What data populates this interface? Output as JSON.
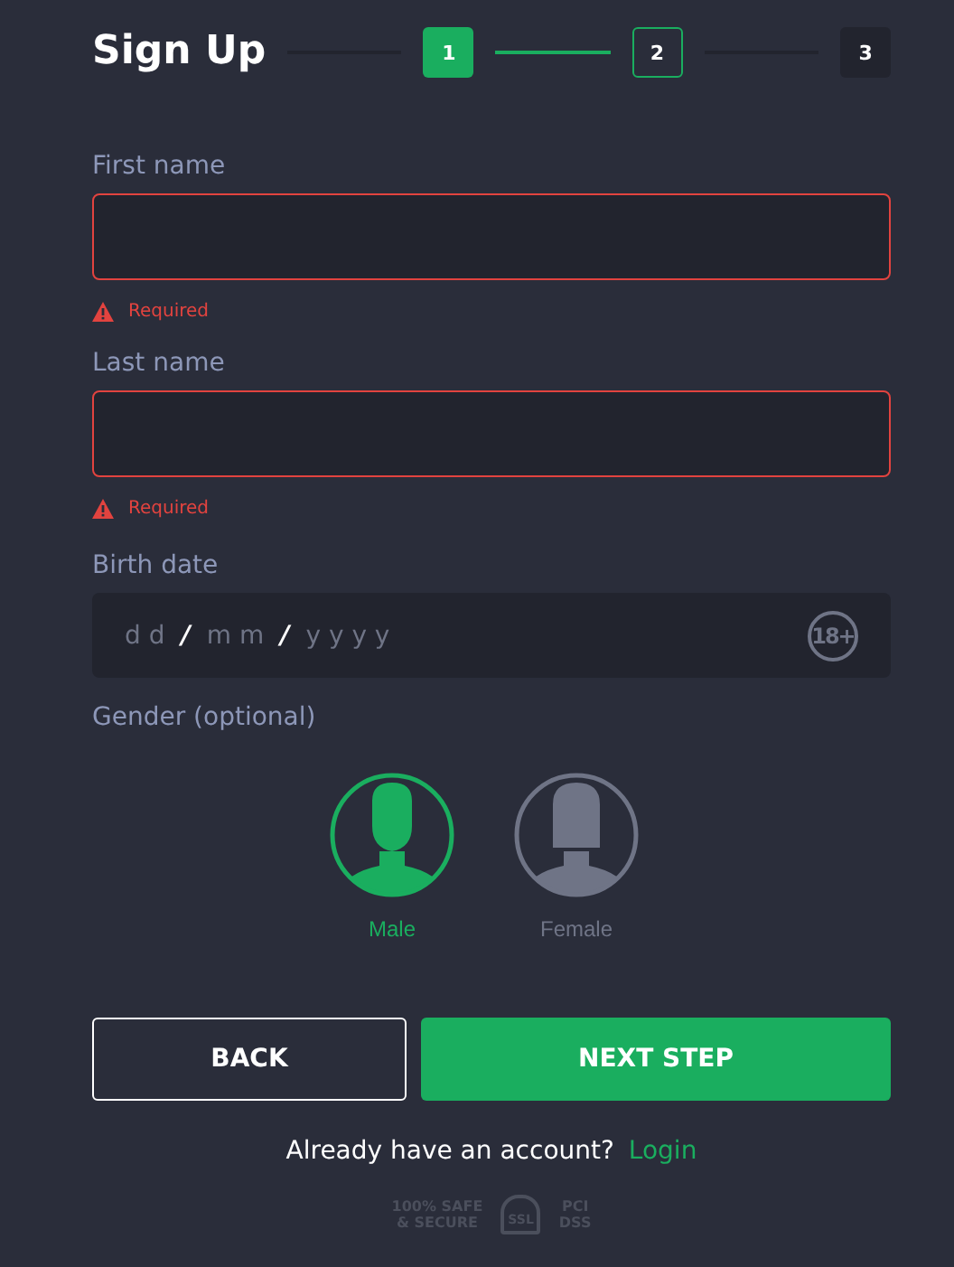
{
  "title": "Sign Up",
  "steps": [
    {
      "label": "1",
      "kind": "current"
    },
    {
      "label": "2",
      "kind": "next"
    },
    {
      "label": "3",
      "kind": "pending"
    }
  ],
  "fields": [
    {
      "label": "First name",
      "error": "Required",
      "invalid": true
    },
    {
      "label": "Last name",
      "error": "Required",
      "invalid": true
    }
  ],
  "birth_date": {
    "label": "Birth date",
    "segments": [
      {
        "text": "d d",
        "kind": "placeholder"
      },
      {
        "text": "/",
        "kind": "separator"
      },
      {
        "text": "m m",
        "kind": "placeholder"
      },
      {
        "text": "/",
        "kind": "separator"
      },
      {
        "text": "y y y y",
        "kind": "placeholder"
      }
    ],
    "badge": "18+"
  },
  "gender": {
    "label": "Gender (optional)",
    "options": [
      {
        "label": "Male",
        "kind": "male",
        "selected": true
      },
      {
        "label": "Female",
        "kind": "female",
        "selected": false
      }
    ]
  },
  "buttons": {
    "back": "BACK",
    "next": "NEXT STEP"
  },
  "login_prompt": {
    "text": "Already have an account?",
    "link": "Login"
  },
  "trust_badges": [
    {
      "kind": "safe",
      "lines": [
        "100% SAFE",
        "& SECURE"
      ]
    },
    {
      "kind": "ssl",
      "lines": [
        "SSL"
      ]
    },
    {
      "kind": "pci",
      "lines": [
        "PCI",
        "DSS"
      ]
    }
  ]
}
